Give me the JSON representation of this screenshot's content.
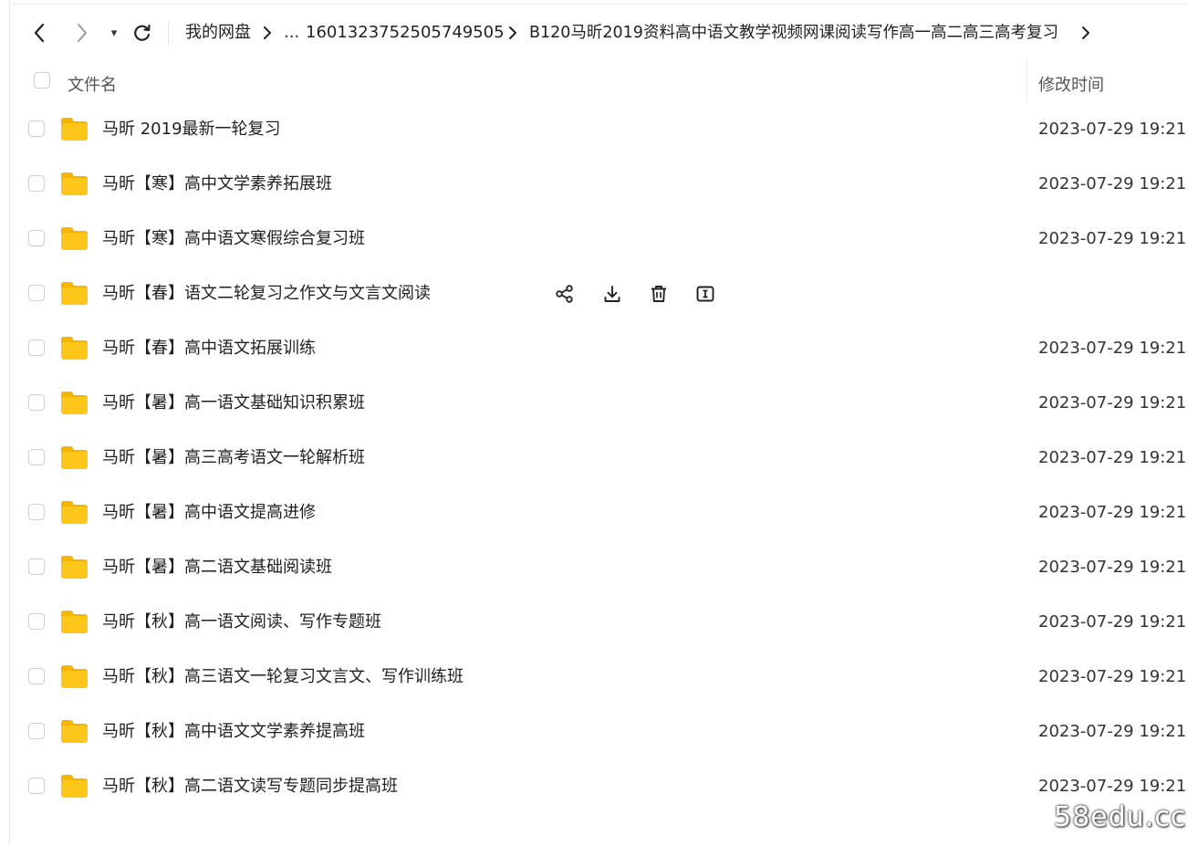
{
  "toolbar": {
    "more_label": "▾",
    "breadcrumbs": [
      "我的网盘",
      "...",
      "1601323752505749505",
      "B120马昕2019资料高中语文教学视频网课阅读写作高一高二高三高考复习"
    ]
  },
  "header": {
    "name_label": "文件名",
    "time_label": "修改时间"
  },
  "files": [
    {
      "name": "马昕 2019最新一轮复习",
      "time": "2023-07-29 19:21"
    },
    {
      "name": "马昕【寒】高中文学素养拓展班",
      "time": "2023-07-29 19:21"
    },
    {
      "name": "马昕【寒】高中语文寒假综合复习班",
      "time": "2023-07-29 19:21"
    },
    {
      "name": "马昕【春】语文二轮复习之作文与文言文阅读",
      "time": ""
    },
    {
      "name": "马昕【春】高中语文拓展训练",
      "time": "2023-07-29 19:21"
    },
    {
      "name": "马昕【暑】高一语文基础知识积累班",
      "time": "2023-07-29 19:21"
    },
    {
      "name": "马昕【暑】高三高考语文一轮解析班",
      "time": "2023-07-29 19:21"
    },
    {
      "name": "马昕【暑】高中语文提高进修",
      "time": "2023-07-29 19:21"
    },
    {
      "name": "马昕【暑】高二语文基础阅读班",
      "time": "2023-07-29 19:21"
    },
    {
      "name": "马昕【秋】高一语文阅读、写作专题班",
      "time": "2023-07-29 19:21"
    },
    {
      "name": "马昕【秋】高三语文一轮复习文言文、写作训练班",
      "time": "2023-07-29 19:21"
    },
    {
      "name": "马昕【秋】高中语文文学素养提高班",
      "time": "2023-07-29 19:21"
    },
    {
      "name": "马昕【秋】高二语文读写专题同步提高班",
      "time": "2023-07-29 19:21"
    }
  ],
  "hover_row_index": 3,
  "hover_actions": [
    "share-icon",
    "download-icon",
    "delete-icon",
    "rename-icon"
  ],
  "colors": {
    "folder": "#FFC61A",
    "folder_tab": "#F5B400",
    "text": "#1f1f1f"
  },
  "watermark": "58edu.cc"
}
